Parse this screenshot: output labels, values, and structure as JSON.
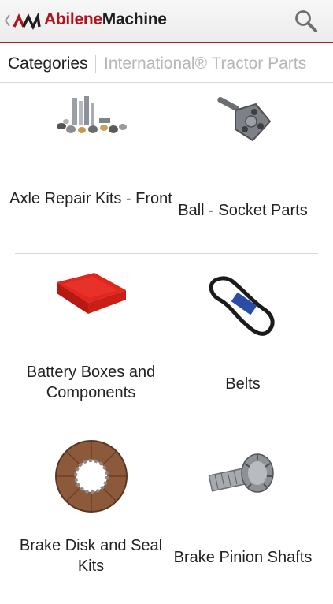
{
  "app": {
    "brand_part1": "Abilene",
    "brand_part2": "Machine",
    "back_icon": "chevron-left-icon",
    "search_icon": "search-icon",
    "accent_color": "#b3121d"
  },
  "breadcrumb": {
    "current": "Categories",
    "next": "International® Tractor Parts"
  },
  "categories": [
    {
      "label": "Axle Repair Kits - Front",
      "icon": "axle-kit-parts-image"
    },
    {
      "label": "Ball - Socket Parts",
      "icon": "ball-socket-part-image"
    },
    {
      "label": "Battery Boxes and Components",
      "icon": "battery-box-image"
    },
    {
      "label": "Belts",
      "icon": "belt-image"
    },
    {
      "label": "Brake Disk and Seal Kits",
      "icon": "brake-disk-image"
    },
    {
      "label": "Brake Pinion Shafts",
      "icon": "pinion-shaft-image"
    }
  ]
}
